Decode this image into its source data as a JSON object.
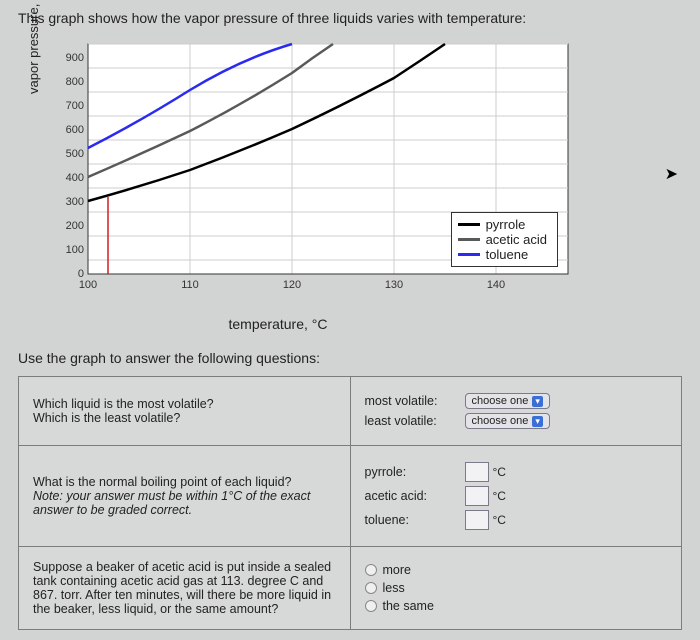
{
  "intro": "This graph shows how the vapor pressure of three liquids varies with temperature:",
  "ylabel": "vapor pressure, torr",
  "xlabel": "temperature,  °C",
  "prompt2": "Use the graph to answer the following questions:",
  "legend": {
    "items": [
      {
        "label": "pyrrole",
        "color": "#000000"
      },
      {
        "label": "acetic acid",
        "color": "#585a59"
      },
      {
        "label": "toluene",
        "color": "#2a2af0"
      }
    ]
  },
  "chart_data": {
    "type": "line",
    "xlabel": "temperature, °C",
    "ylabel": "vapor pressure, torr",
    "xlim": [
      100,
      147
    ],
    "ylim": [
      0,
      950
    ],
    "xticks": [
      100,
      110,
      120,
      130,
      140
    ],
    "yticks": [
      0,
      100,
      200,
      300,
      400,
      500,
      600,
      700,
      800,
      900
    ],
    "series": [
      {
        "name": "toluene",
        "color": "#2a2af0",
        "x": [
          100,
          105,
          110,
          115,
          120
        ],
        "y": [
          520,
          630,
          760,
          890,
          950
        ]
      },
      {
        "name": "acetic acid",
        "color": "#585a59",
        "x": [
          100,
          105,
          110,
          115,
          120,
          124
        ],
        "y": [
          400,
          490,
          590,
          700,
          830,
          950
        ]
      },
      {
        "name": "pyrrole",
        "color": "#000000",
        "x": [
          100,
          105,
          110,
          115,
          120,
          125,
          130,
          135
        ],
        "y": [
          300,
          360,
          430,
          510,
          600,
          700,
          810,
          940
        ]
      }
    ],
    "marker_line": {
      "x": 102,
      "y_from": 0,
      "y_to": 320,
      "color": "#d02020"
    }
  },
  "questions": {
    "q1": {
      "prompt_a": "Which liquid is the most volatile?",
      "prompt_b": "Which is the least volatile?",
      "ans_a_label": "most volatile:",
      "ans_b_label": "least volatile:",
      "choose_text": "choose one"
    },
    "q2": {
      "prompt_a": "What is the normal boiling point of each liquid?",
      "prompt_b": "Note: your answer must be within 1°C of the exact answer to be graded correct.",
      "rows": [
        {
          "label": "pyrrole:",
          "unit": "°C"
        },
        {
          "label": "acetic acid:",
          "unit": "°C"
        },
        {
          "label": "toluene:",
          "unit": "°C"
        }
      ]
    },
    "q3": {
      "prompt": "Suppose a beaker of acetic acid is put inside a sealed tank containing acetic acid gas at 113. degree C and 867. torr. After ten minutes, will there be more liquid in the beaker, less liquid, or the same amount?",
      "options": [
        "more",
        "less",
        "the same"
      ]
    }
  }
}
